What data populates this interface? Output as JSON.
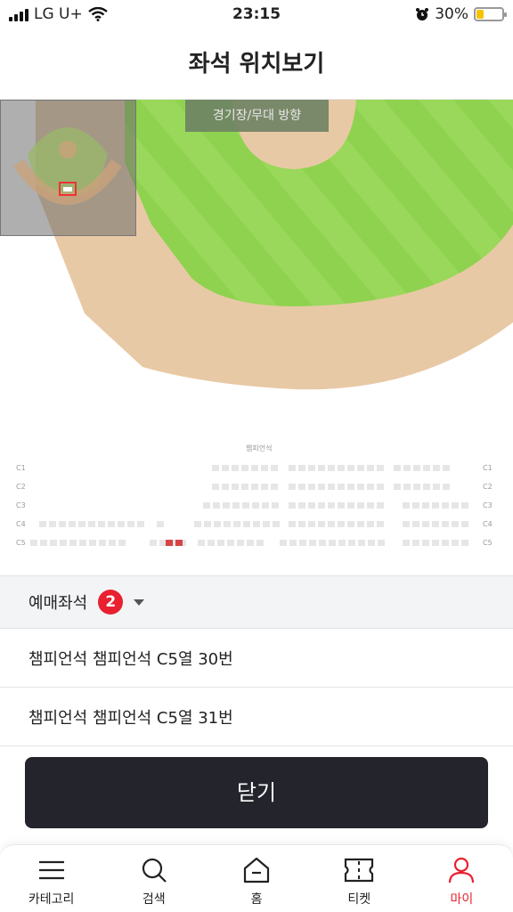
{
  "status": {
    "carrier": "LG U+",
    "time": "23:15",
    "battery": "30%",
    "battery_level": 0.3
  },
  "header": {
    "title": "좌석 위치보기"
  },
  "map": {
    "stage_label": "경기장/무대 방향",
    "section_label": "챔피언석",
    "rows": [
      "C1",
      "C2",
      "C3",
      "C4",
      "C5"
    ]
  },
  "reserved": {
    "title": "예매좌석",
    "count": "2",
    "seats": [
      "챔피언석 챔피언석 C5열 30번",
      "챔피언석 챔피언석 C5열 31번"
    ]
  },
  "close_button": "닫기",
  "tabs": [
    {
      "label": "카테고리",
      "icon": "menu-icon"
    },
    {
      "label": "검색",
      "icon": "search-icon"
    },
    {
      "label": "홈",
      "icon": "home-icon"
    },
    {
      "label": "티켓",
      "icon": "ticket-icon"
    },
    {
      "label": "마이",
      "icon": "person-icon"
    }
  ],
  "colors": {
    "accent": "#e8202f",
    "field_green": "#8fd24f",
    "dirt": "#e8c9a5",
    "button": "#24242c"
  }
}
